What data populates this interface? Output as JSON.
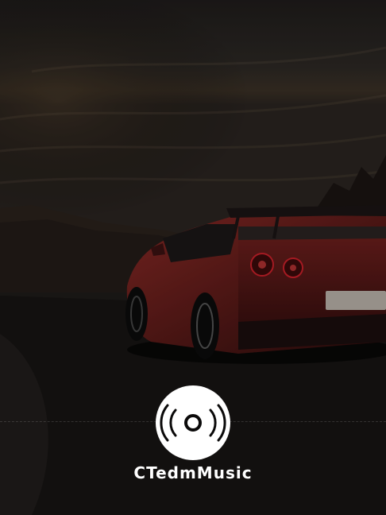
{
  "screen": {
    "kind": "splash",
    "background_image": "sports-car-sunset-road",
    "accent_color": "#ffffff",
    "tail_light_color": "#c8202a"
  },
  "logo": {
    "icon": "vinyl-disc-icon",
    "brand_name": "CTedmMusic"
  }
}
